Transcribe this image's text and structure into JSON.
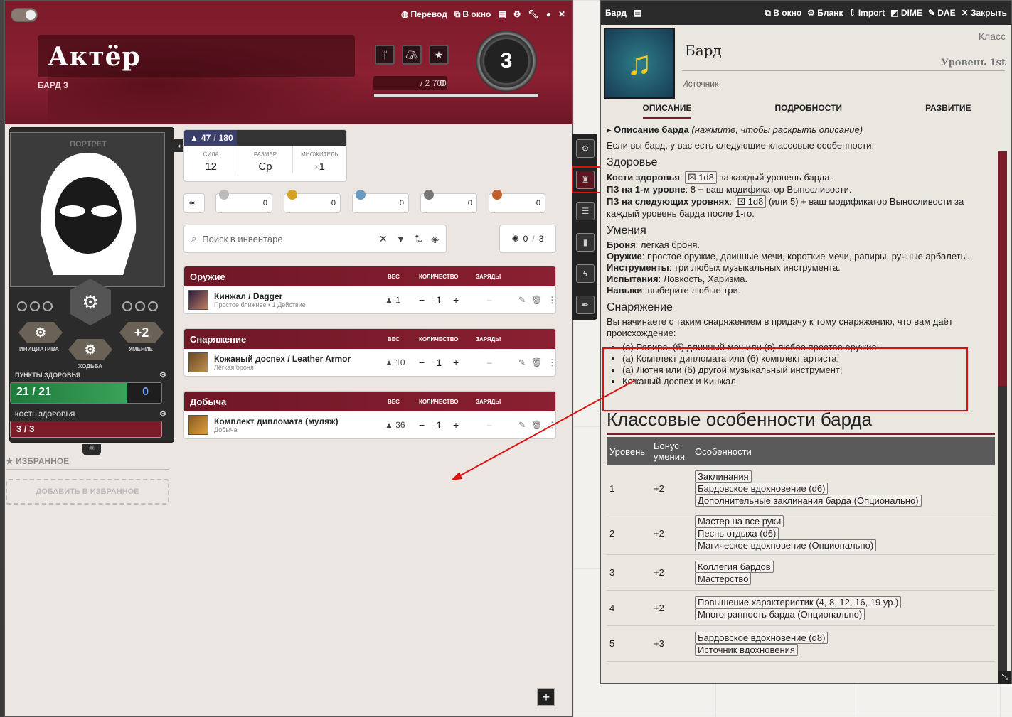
{
  "topbar": {
    "translate": "Перевод",
    "window": "В окно"
  },
  "character": {
    "name": "Актёр",
    "subtitle": "БАРД 3",
    "level": "3",
    "xp": "0",
    "xp_max": "/ 2 700"
  },
  "portrait": {
    "label": "ПОРТРЕТ"
  },
  "stats": {
    "initiative_label": "ИНИЦИАТИВА",
    "movement_label": "ХОДЬБА",
    "proficiency_label": "УМЕНИЕ",
    "proficiency": "+2",
    "hp_label": "ПУНКТЫ ЗДОРОВЬЯ",
    "hp": "21 / 21",
    "hp_temp": "0",
    "hd_label": "КОСТЬ ЗДОРОВЬЯ",
    "hd": "3 / 3"
  },
  "favorites": {
    "title": "ИЗБРАННОЕ",
    "add": "ДОБАВИТЬ В ИЗБРАННОЕ"
  },
  "encumbrance": {
    "value": "47",
    "max": "180",
    "str_label": "СИЛА",
    "str": "12",
    "size_label": "РАЗМЕР",
    "size": "Ср",
    "mult_label": "МНОЖИТЕЛЬ",
    "mult": "1",
    "mult_prefix": "×"
  },
  "currency": [
    "0",
    "0",
    "0",
    "0",
    "0"
  ],
  "search": {
    "placeholder": "Поиск в инвентаре"
  },
  "attune": {
    "value": "0",
    "sep": "/",
    "max": "3"
  },
  "columns": {
    "weight": "ВЕС",
    "qty": "КОЛИЧЕСТВО",
    "charges": "ЗАРЯДЫ"
  },
  "sections": [
    {
      "title": "Оружие",
      "items": [
        {
          "name": "Кинжал / Dagger",
          "sub": "Простое ближнее • 1 Действие",
          "weight": "1",
          "qty": "1",
          "charges": "–"
        }
      ]
    },
    {
      "title": "Снаряжение",
      "items": [
        {
          "name": "Кожаный доспех / Leather Armor",
          "sub": "Лёгкая броня",
          "weight": "10",
          "qty": "1",
          "charges": "–"
        }
      ]
    },
    {
      "title": "Добыча",
      "items": [
        {
          "name": "Комплект дипломата (муляж)",
          "sub": "Добыча",
          "weight": "36",
          "qty": "1",
          "charges": "–"
        }
      ]
    }
  ],
  "class_window": {
    "title": "Бард",
    "toolbar": [
      "В окно",
      "Бланк",
      "Import",
      "DIME",
      "DAE",
      "Закрыть"
    ],
    "name": "Бард",
    "klass": "Класс",
    "level": "Уровень 1st",
    "source": "Источник",
    "tabs": [
      "ОПИСАНИЕ",
      "ПОДРОБНОСТИ",
      "РАЗВИТИЕ"
    ],
    "summary_bold": "Описание барда",
    "summary_it": "(нажмите, чтобы раскрыть описание)",
    "intro": "Если вы бард, у вас есть следующие классовые особенности:",
    "h_health": "Здоровье",
    "hd_label": "Кости здоровья",
    "hd_die": "1d8",
    "hd_text": "за каждый уровень барда.",
    "hp1_label": "ПЗ на 1-м уровне",
    "hp1_text": ": 8 + ваш модификатор Выносливости.",
    "hpn_label": "ПЗ на следующих уровнях",
    "hpn_die": "1d8",
    "hpn_text": "(или 5) + ваш модификатор Выносливости за каждый уровень барда после 1-го.",
    "h_skills": "Умения",
    "armor_l": "Броня",
    "armor": ": лёгкая броня.",
    "weapons_l": "Оружие",
    "weapons": ": простое оружие, длинные мечи, короткие мечи, рапиры, ручные арбалеты.",
    "tools_l": "Инструменты",
    "tools": ": три любых музыкальных инструмента.",
    "saves_l": "Испытания",
    "saves": ": Ловкость, Харизма.",
    "skills_l": "Навыки",
    "skills": ": выберите любые три.",
    "h_equip": "Снаряжение",
    "equip_intro": "Вы начинаете с таким снаряжением в придачу к тому снаряжению, что вам даёт происхождение:",
    "equip": [
      "(а) Рапира, (б) длинный меч или (в) любое простое оружие;",
      "(а) Комплект дипломата или (б) комплект артиста;",
      "(а) Лютня или (б) другой музыкальный инструмент;",
      "Кожаный доспех и Кинжал"
    ],
    "features_title": "Классовые особенности барда",
    "table_head": [
      "Уровень",
      "Бонус умения",
      "Особенности"
    ],
    "rows": [
      {
        "lvl": "1",
        "bonus": "+2",
        "feats": [
          "Заклинания",
          "Бардовское вдохновение (d6)",
          "Дополнительные заклинания барда (Опционально)"
        ]
      },
      {
        "lvl": "2",
        "bonus": "+2",
        "feats": [
          "Мастер на все руки",
          "Песнь отдыха (d6)",
          "Магическое вдохновение (Опционально)"
        ]
      },
      {
        "lvl": "3",
        "bonus": "+2",
        "feats": [
          "Коллегия бардов",
          "Мастерство"
        ]
      },
      {
        "lvl": "4",
        "bonus": "+2",
        "feats": [
          "Повышение характеристик (4, 8, 12, 16, 19 ур.)",
          "Многогранность барда (Опционально)"
        ]
      },
      {
        "lvl": "5",
        "bonus": "+3",
        "feats": [
          "Бардовское вдохновение (d8)",
          "Источник вдохновения"
        ]
      }
    ]
  },
  "colors": {
    "accent": "#7c1b2a",
    "highlight": "#e01010"
  }
}
